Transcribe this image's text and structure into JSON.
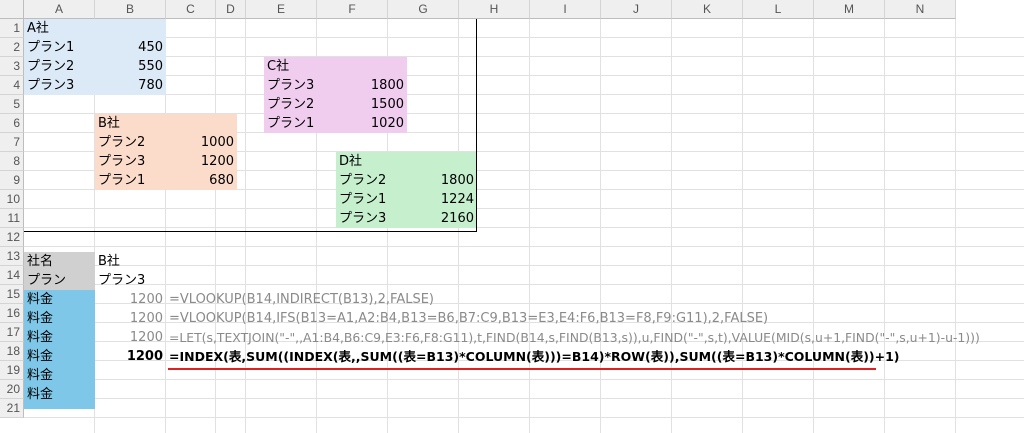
{
  "columns": [
    "A",
    "B",
    "C",
    "D",
    "E",
    "F",
    "G",
    "H",
    "I",
    "J",
    "K",
    "L",
    "M",
    "N"
  ],
  "rows": [
    "1",
    "2",
    "3",
    "4",
    "5",
    "6",
    "7",
    "8",
    "9",
    "10",
    "11",
    "12",
    "13",
    "14",
    "15",
    "16",
    "17",
    "18",
    "19",
    "20",
    "21"
  ],
  "colors": {
    "company_a": "#dce9f7",
    "company_b": "#fbdccb",
    "company_c": "#f0cdef",
    "company_d": "#c6efce",
    "label_gray": "#d0d0d0",
    "result_blue": "#7fc7e8",
    "underline_red": "#e02020"
  },
  "company_a": {
    "title": "A社",
    "rows": [
      {
        "plan": "プラン1",
        "value": "450"
      },
      {
        "plan": "プラン2",
        "value": "550"
      },
      {
        "plan": "プラン3",
        "value": "780"
      }
    ]
  },
  "company_b": {
    "title": "B社",
    "rows": [
      {
        "plan": "プラン2",
        "value": "1000"
      },
      {
        "plan": "プラン3",
        "value": "1200"
      },
      {
        "plan": "プラン1",
        "value": "680"
      }
    ]
  },
  "company_c": {
    "title": "C社",
    "rows": [
      {
        "plan": "プラン3",
        "value": "1800"
      },
      {
        "plan": "プラン2",
        "value": "1500"
      },
      {
        "plan": "プラン1",
        "value": "1020"
      }
    ]
  },
  "company_d": {
    "title": "D社",
    "rows": [
      {
        "plan": "プラン2",
        "value": "1800"
      },
      {
        "plan": "プラン1",
        "value": "1224"
      },
      {
        "plan": "プラン3",
        "value": "2160"
      }
    ]
  },
  "lookup": {
    "company_label": "社名",
    "company_value": "B社",
    "plan_label": "プラン",
    "plan_value": "プラン3",
    "price_label": "料金"
  },
  "results": [
    {
      "value": "1200",
      "formula": "=VLOOKUP(B14,INDIRECT(B13),2,FALSE)"
    },
    {
      "value": "1200",
      "formula": "=VLOOKUP(B14,IFS(B13=A1,A2:B4,B13=B6,B7:C9,B13=E3,E4:F6,B13=F8,F9:G11),2,FALSE)"
    },
    {
      "value": "1200",
      "formula": "=LET(s,TEXTJOIN(\"-\",,A1:B4,B6:C9,E3:F6,F8:G11),t,FIND(B14,s,FIND(B13,s)),u,FIND(\"-\",s,t),VALUE(MID(s,u+1,FIND(\"-\",s,u+1)-u-1)))"
    },
    {
      "value": "1200",
      "formula": "=INDEX(表,SUM((INDEX(表,,SUM((表=B13)*COLUMN(表)))=B14)*ROW(表)),SUM((表=B13)*COLUMN(表))+1)"
    }
  ]
}
